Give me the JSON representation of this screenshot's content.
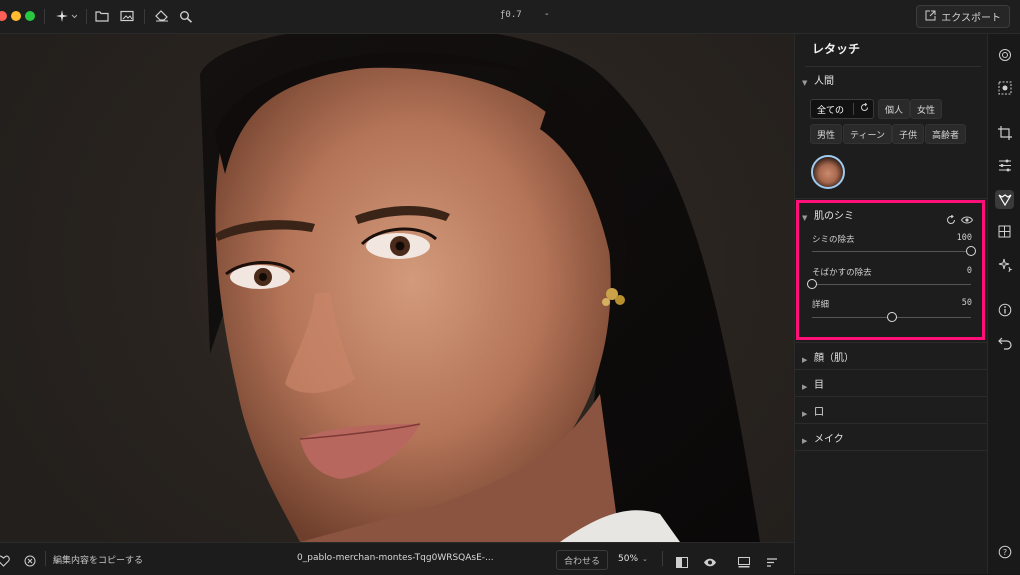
{
  "toolbar": {
    "version_label": "ƒ0.7",
    "dash_label": "-",
    "export_label": "エクスポート"
  },
  "panel": {
    "title": "レタッチ",
    "people_section": {
      "label": "人間",
      "chips_row1": [
        "全ての",
        "個人",
        "女性"
      ],
      "chips_row2": [
        "男性",
        "ティーン",
        "子供",
        "高齢者"
      ]
    },
    "skin_section": {
      "label": "肌のシミ",
      "sliders": [
        {
          "label": "シミの除去",
          "value": "100",
          "level": 1.0
        },
        {
          "label": "そばかすの除去",
          "value": "0",
          "level": 0.0
        },
        {
          "label": "詳細",
          "value": "50",
          "level": 0.5
        }
      ]
    },
    "collapsed_sections": [
      "顔（肌）",
      "目",
      "口",
      "メイク"
    ]
  },
  "bottombar": {
    "copy_edits_label": "編集内容をコピーする",
    "filename": "0_pablo-merchan-montes-Tqg0WRSQAsE-...",
    "fit_label": "合わせる",
    "zoom_label": "50%"
  },
  "colors": {
    "highlight": "#ff0f78",
    "avatar_ring": "#9ecbf0"
  }
}
